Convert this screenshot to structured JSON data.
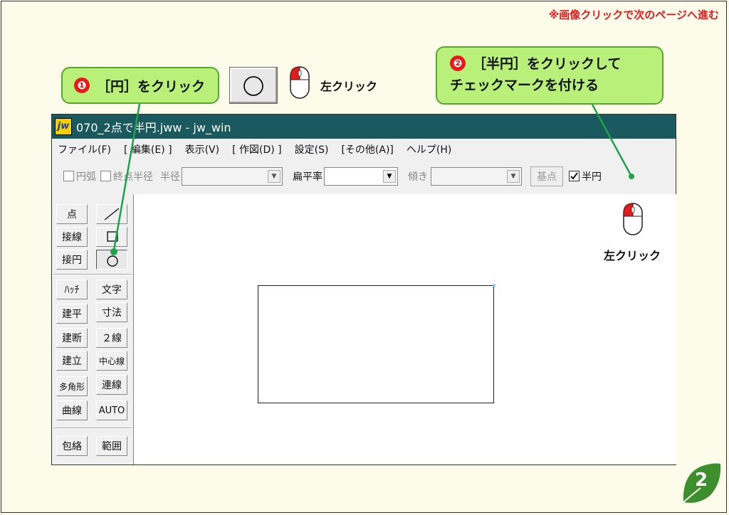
{
  "header": {
    "note": "※画像クリックで次のページへ進む"
  },
  "callout1": {
    "number": "❶",
    "text": "［円］をクリック"
  },
  "callout2": {
    "number": "❷",
    "line1": "［半円］をクリックして",
    "line2": "チェックマークを付ける"
  },
  "left_click_label": "左クリック",
  "window": {
    "title": "070_2点で半円.jww - jw_win",
    "app_icon": "jw",
    "menu": [
      "ファイル(F)",
      "[ 編集(E) ]",
      "表示(V)",
      "[ 作図(D) ]",
      "設定(S)",
      "[その他(A)]",
      "ヘルプ(H)"
    ],
    "toolbar": {
      "arc_label": "円弧",
      "end_radius_label": "終点半径",
      "radius_label": "半径",
      "flat_ratio_label": "扁平率",
      "tilt_label": "傾き",
      "base_point_label": "基点",
      "semicircle_label": "半円",
      "semicircle_checked": true
    },
    "palette_left": [
      "点",
      "接線",
      "接円",
      "ﾊｯﾁ",
      "建平",
      "建断",
      "建立",
      "多角形",
      "曲線",
      "包絡"
    ],
    "palette_right": [
      "文字",
      "寸法",
      "２線",
      "中心線",
      "連線",
      "AUTO",
      "範囲"
    ]
  },
  "page_number": "2",
  "colors": {
    "accent_red": "#e8191b",
    "callout_green": "#b8f07a",
    "title_bar": "#1a5a5e",
    "pointer_line": "#1ea34a"
  }
}
